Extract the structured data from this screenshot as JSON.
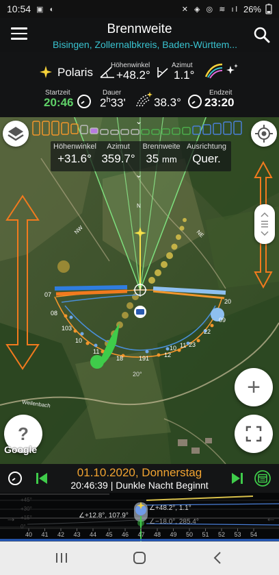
{
  "status": {
    "time": "10:54",
    "battery": "26%"
  },
  "header": {
    "title": "Brennweite",
    "subtitle": "Bisingen, Zollernalbkreis, Baden-Württem..."
  },
  "info": {
    "object": "Polaris",
    "hoehen_label": "Höhenwinkel",
    "hoehen_value": "+48.2°",
    "azimut_label": "Azimut",
    "azimut_value": "1.1°",
    "start_label": "Startzeit",
    "start_value": "20:46",
    "dauer_label": "Dauer",
    "dauer_value_h": "2",
    "dauer_unit_h": "h",
    "dauer_value_m": "33'",
    "mid_value": "38.3°",
    "end_label": "Endzeit",
    "end_value": "23:20"
  },
  "readout": {
    "hoehen_label": "Höhenwinkel",
    "hoehen_value": "+31.6°",
    "azimut_label": "Azimut",
    "azimut_value": "359.7°",
    "brenn_label": "Brennweite",
    "brenn_value": "35",
    "brenn_unit": "mm",
    "ausr_label": "Ausrichtung",
    "ausr_value": "Quer."
  },
  "map": {
    "compass": {
      "n": "N",
      "nw": "NW",
      "ne": "NE"
    },
    "hour_labels_left": [
      "07",
      "08",
      "103",
      "10",
      "11"
    ],
    "hour_labels_bottom": [
      "18",
      "191",
      "12",
      "10",
      "11",
      "23"
    ],
    "hour_labels_right": [
      "20",
      "09",
      "22"
    ],
    "horizon_label": "20°",
    "road_label": "Weilenbach",
    "google": "Google"
  },
  "datebar": {
    "date": "01.10.2020, Donnerstag",
    "time": "20:46:39",
    "phase": "Dunkle Nacht Beginnt"
  },
  "timeline": {
    "label_sun": "∠+48.2°, 1.1°",
    "label_moon_up": "∠+12.8°, 107.9°",
    "label_moon_down": "∠−18.0°, 285.4°",
    "left_deg": [
      "+45°",
      "+30°",
      "+15°",
      "0°"
    ],
    "ticks": [
      "40",
      "41",
      "42",
      "43",
      "44",
      "45",
      "46",
      "47",
      "48",
      "49",
      "50",
      "51",
      "52",
      "53",
      "54"
    ]
  },
  "colors": {
    "accent_cyan": "#39c3d0",
    "green": "#5fd068",
    "orange": "#f2a431",
    "yellow": "#f6d23a"
  }
}
